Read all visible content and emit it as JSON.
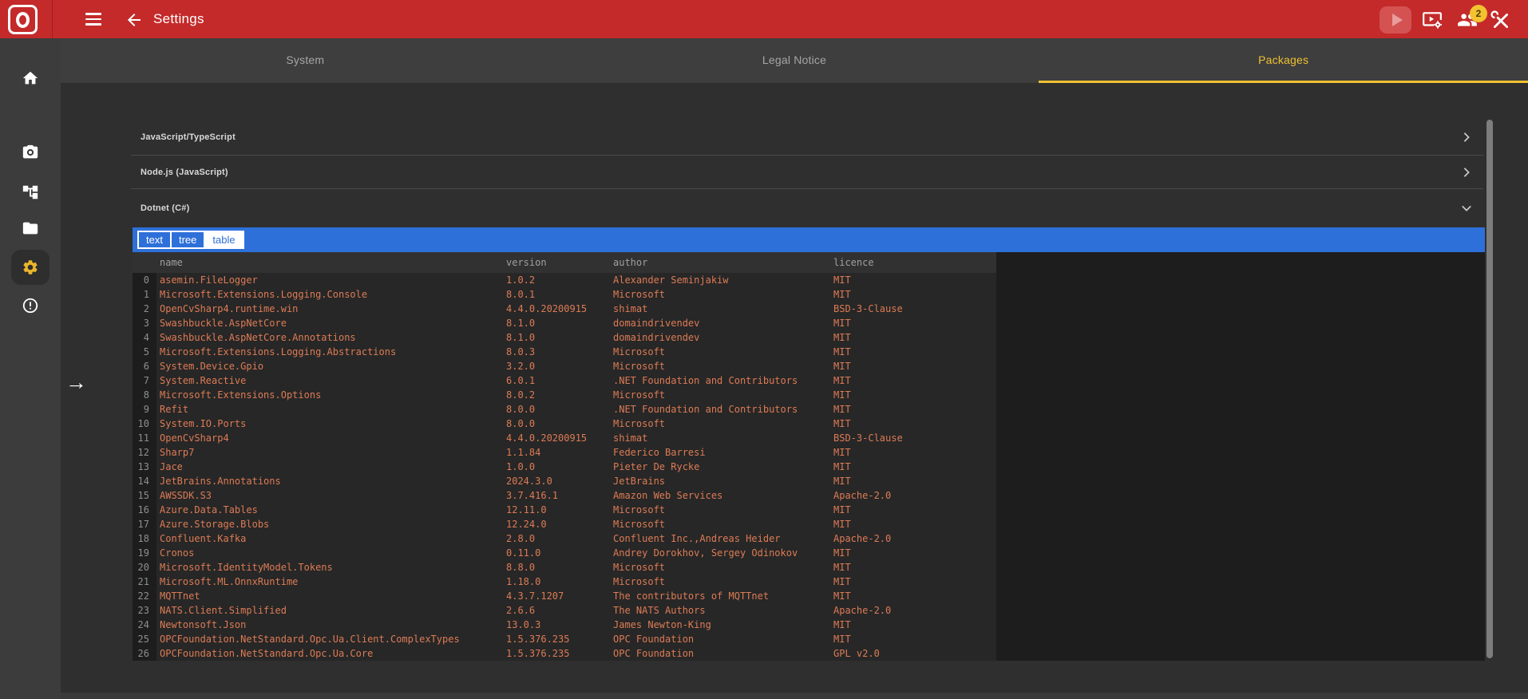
{
  "colors": {
    "header_red": "#c42a2a",
    "accent_yellow": "#f0c231",
    "accent_blue": "#2e70d9",
    "table_text_orange": "#dd7b55"
  },
  "header": {
    "title": "Settings",
    "badge_count": "2",
    "icons": [
      "menu-icon",
      "back-arrow-icon",
      "play-icon",
      "screen-cast-settings-icon",
      "users-icon",
      "service-tools-icon"
    ]
  },
  "tabs": [
    {
      "label": "System"
    },
    {
      "label": "Legal Notice"
    },
    {
      "label": "Packages"
    }
  ],
  "active_tab": "Packages",
  "sidebar": {
    "items": [
      {
        "icon": "home-icon"
      },
      {
        "icon": "camera-icon"
      },
      {
        "icon": "workflow-tree-icon"
      },
      {
        "icon": "folder-icon"
      },
      {
        "icon": "settings-gear-icon",
        "active": true
      },
      {
        "icon": "error-icon"
      }
    ]
  },
  "packages": {
    "sections": [
      {
        "label": "JavaScript/TypeScript",
        "expanded": false
      },
      {
        "label": "Node.js (JavaScript)",
        "expanded": false
      },
      {
        "label": "Dotnet (C#)",
        "expanded": true
      }
    ],
    "view_modes": {
      "text": "text",
      "tree": "tree",
      "table": "table",
      "selected": "table"
    },
    "table": {
      "columns": [
        "name",
        "version",
        "author",
        "licence"
      ],
      "rows": [
        {
          "index": "0",
          "name": "asemin.FileLogger",
          "version": "1.0.2",
          "author": "Alexander Seminjakiw",
          "licence": "MIT"
        },
        {
          "index": "1",
          "name": "Microsoft.Extensions.Logging.Console",
          "version": "8.0.1",
          "author": "Microsoft",
          "licence": "MIT"
        },
        {
          "index": "2",
          "name": "OpenCvSharp4.runtime.win",
          "version": "4.4.0.20200915",
          "author": "shimat",
          "licence": "BSD-3-Clause"
        },
        {
          "index": "3",
          "name": "Swashbuckle.AspNetCore",
          "version": "8.1.0",
          "author": "domaindrivendev",
          "licence": "MIT"
        },
        {
          "index": "4",
          "name": "Swashbuckle.AspNetCore.Annotations",
          "version": "8.1.0",
          "author": "domaindrivendev",
          "licence": "MIT"
        },
        {
          "index": "5",
          "name": "Microsoft.Extensions.Logging.Abstractions",
          "version": "8.0.3",
          "author": "Microsoft",
          "licence": "MIT"
        },
        {
          "index": "6",
          "name": "System.Device.Gpio",
          "version": "3.2.0",
          "author": "Microsoft",
          "licence": "MIT"
        },
        {
          "index": "7",
          "name": "System.Reactive",
          "version": "6.0.1",
          "author": ".NET Foundation and Contributors",
          "licence": "MIT"
        },
        {
          "index": "8",
          "name": "Microsoft.Extensions.Options",
          "version": "8.0.2",
          "author": "Microsoft",
          "licence": "MIT"
        },
        {
          "index": "9",
          "name": "Refit",
          "version": "8.0.0",
          "author": ".NET Foundation and Contributors",
          "licence": "MIT"
        },
        {
          "index": "10",
          "name": "System.IO.Ports",
          "version": "8.0.0",
          "author": "Microsoft",
          "licence": "MIT"
        },
        {
          "index": "11",
          "name": "OpenCvSharp4",
          "version": "4.4.0.20200915",
          "author": "shimat",
          "licence": "BSD-3-Clause"
        },
        {
          "index": "12",
          "name": "Sharp7",
          "version": "1.1.84",
          "author": "Federico Barresi",
          "licence": "MIT"
        },
        {
          "index": "13",
          "name": "Jace",
          "version": "1.0.0",
          "author": "Pieter De Rycke",
          "licence": "MIT"
        },
        {
          "index": "14",
          "name": "JetBrains.Annotations",
          "version": "2024.3.0",
          "author": "JetBrains",
          "licence": "MIT"
        },
        {
          "index": "15",
          "name": "AWSSDK.S3",
          "version": "3.7.416.1",
          "author": "Amazon Web Services",
          "licence": "Apache-2.0"
        },
        {
          "index": "16",
          "name": "Azure.Data.Tables",
          "version": "12.11.0",
          "author": "Microsoft",
          "licence": "MIT"
        },
        {
          "index": "17",
          "name": "Azure.Storage.Blobs",
          "version": "12.24.0",
          "author": "Microsoft",
          "licence": "MIT"
        },
        {
          "index": "18",
          "name": "Confluent.Kafka",
          "version": "2.8.0",
          "author": "Confluent Inc.,Andreas Heider",
          "licence": "Apache-2.0"
        },
        {
          "index": "19",
          "name": "Cronos",
          "version": "0.11.0",
          "author": "Andrey Dorokhov, Sergey Odinokov",
          "licence": "MIT"
        },
        {
          "index": "20",
          "name": "Microsoft.IdentityModel.Tokens",
          "version": "8.8.0",
          "author": "Microsoft",
          "licence": "MIT"
        },
        {
          "index": "21",
          "name": "Microsoft.ML.OnnxRuntime",
          "version": "1.18.0",
          "author": "Microsoft",
          "licence": "MIT"
        },
        {
          "index": "22",
          "name": "MQTTnet",
          "version": "4.3.7.1207",
          "author": "The contributors of MQTTnet",
          "licence": "MIT"
        },
        {
          "index": "23",
          "name": "NATS.Client.Simplified",
          "version": "2.6.6",
          "author": "The NATS Authors",
          "licence": "Apache-2.0"
        },
        {
          "index": "24",
          "name": "Newtonsoft.Json",
          "version": "13.0.3",
          "author": "James Newton-King",
          "licence": "MIT"
        },
        {
          "index": "25",
          "name": "OPCFoundation.NetStandard.Opc.Ua.Client.ComplexTypes",
          "version": "1.5.376.235",
          "author": "OPC Foundation",
          "licence": "MIT"
        },
        {
          "index": "26",
          "name": "OPCFoundation.NetStandard.Opc.Ua.Core",
          "version": "1.5.376.235",
          "author": "OPC Foundation",
          "licence": "GPL v2.0"
        }
      ]
    }
  }
}
